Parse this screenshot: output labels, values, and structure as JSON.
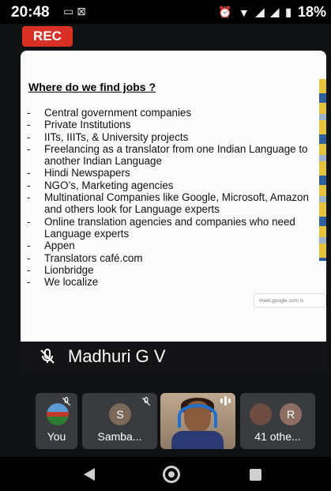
{
  "status_bar": {
    "time": "20:48",
    "left_icons": [
      "cast-icon",
      "gallery-icon"
    ],
    "right_icons": [
      "alarm-icon",
      "wifi-icon",
      "signal-icon",
      "signal-icon",
      "battery-icon"
    ],
    "battery": "18%"
  },
  "recording": {
    "label": "REC",
    "color": "#d93025"
  },
  "presenter": {
    "name": "Madhuri G V",
    "muted": true,
    "slide": {
      "title": "Where do we find jobs ?",
      "items": [
        "Central government companies",
        "Private Institutions",
        "IITs, IIITs, & University projects",
        "Freelancing as a translator from one Indian Language to another Indian Language",
        "Hindi Newspapers",
        "NGO’s, Marketing agencies",
        "Multinational Companies like Google, Microsoft, Amazon and others look for Language experts",
        "Online translation agencies and companies who need Language experts",
        "Appen",
        "Translators café.com",
        "Lionbridge",
        "We localize"
      ],
      "share_chip": "meet.google.com is"
    }
  },
  "participants": [
    {
      "label": "You",
      "muted": true
    },
    {
      "label": "Samba...",
      "initial": "S",
      "muted": true
    },
    {
      "label": "",
      "speaking": true
    },
    {
      "label": "41 othe...",
      "initial": "R"
    }
  ],
  "nav": [
    "back-icon",
    "home-icon",
    "recents-icon"
  ]
}
